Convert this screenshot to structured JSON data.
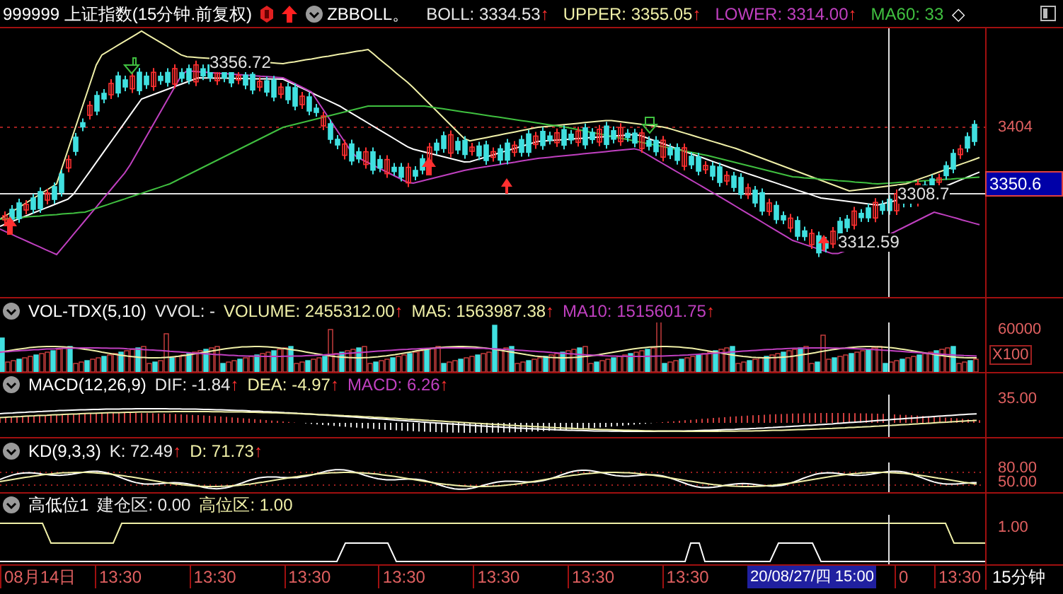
{
  "header": {
    "symbol": "999999 上证指数(15分钟.前复权)",
    "study": "ZBBOLL。",
    "trailing": "◇",
    "indicators": [
      {
        "label": "BOLL: 3334.53",
        "arrow": "↑",
        "color": "#e8e8e8"
      },
      {
        "label": "UPPER: 3355.05",
        "arrow": "↑",
        "color": "#f0f0a8"
      },
      {
        "label": "LOWER: 3314.00",
        "arrow": "↑",
        "color": "#c040c0"
      },
      {
        "label": "MA60: 33",
        "color": "#40c040"
      }
    ]
  },
  "price_axis": [
    {
      "text": "3404",
      "kind": "tick"
    },
    {
      "text": "3350.6",
      "kind": "current"
    }
  ],
  "price_annotations": [
    "3356.72",
    "3312.59",
    "3308.7"
  ],
  "panels": [
    {
      "kind": "volume",
      "title": "VOL-TDX(5,10)",
      "indicators": [
        {
          "label": "VVOL: -",
          "color": "#e8e8e8"
        },
        {
          "label": "VOLUME: 2455312.00",
          "arrow": "↑",
          "color": "#f0f0a8"
        },
        {
          "label": "MA5: 1563987.38",
          "arrow": "↑",
          "color": "#f0f0a8"
        },
        {
          "label": "MA10: 1515601.75",
          "arrow": "↑",
          "color": "#c040c0"
        }
      ],
      "axis": [
        {
          "text": "60000",
          "kind": "tick"
        },
        {
          "text": "X100",
          "kind": "unit"
        }
      ]
    },
    {
      "kind": "macd",
      "title": "MACD(12,26,9)",
      "indicators": [
        {
          "label": "DIF: -1.84",
          "arrow": "↑",
          "color": "#e8e8e8"
        },
        {
          "label": "DEA: -4.97",
          "arrow": "↑",
          "color": "#f0f0a8"
        },
        {
          "label": "MACD: 6.26",
          "arrow": "↑",
          "color": "#c040c0"
        }
      ],
      "axis": [
        {
          "text": "35.00",
          "kind": "tick"
        }
      ]
    },
    {
      "kind": "kd",
      "title": "KD(9,3,3)",
      "indicators": [
        {
          "label": "K: 72.49",
          "arrow": "↑",
          "color": "#e8e8e8"
        },
        {
          "label": "D: 71.73",
          "arrow": "↑",
          "color": "#f0f0a8"
        }
      ],
      "axis": [
        {
          "text": "80.00",
          "kind": "tick"
        },
        {
          "text": "50.00",
          "kind": "tick"
        }
      ]
    },
    {
      "kind": "level",
      "title": "高低位1",
      "indicators": [
        {
          "label": "建仓区: 0.00",
          "color": "#e8e8e8"
        },
        {
          "label": "高位区: 1.00",
          "color": "#f0f0a8"
        }
      ],
      "axis": [
        {
          "text": "1.00",
          "kind": "tick"
        }
      ]
    }
  ],
  "time_axis": {
    "labels": [
      "08月14日",
      "13:30",
      "13:30",
      "13:30",
      "13:30",
      "13:30",
      "13:30",
      "13:30",
      "0",
      "13:30"
    ],
    "cursor": "20/08/27/四 15:00",
    "period": "15分钟"
  }
}
